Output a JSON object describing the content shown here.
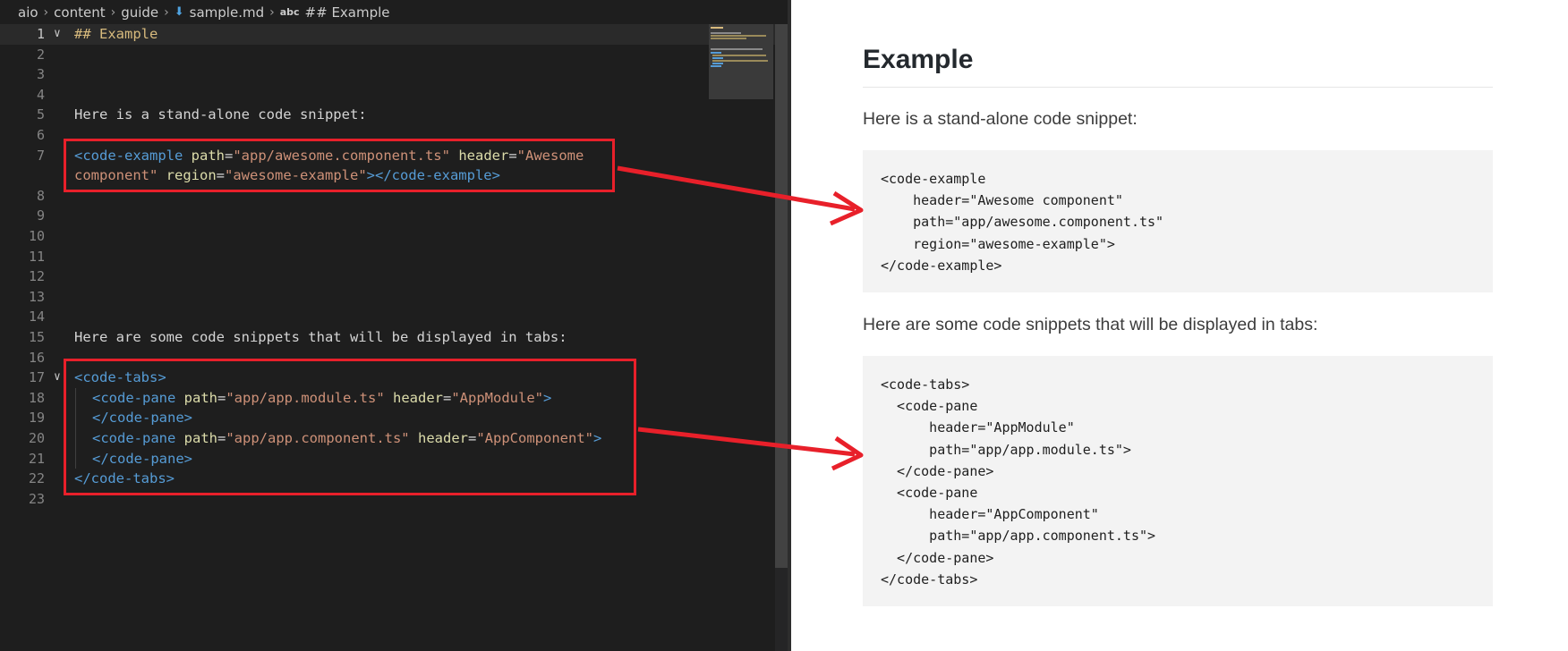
{
  "breadcrumb": {
    "items": [
      "aio",
      "content",
      "guide",
      "sample.md",
      "## Example"
    ],
    "separator": "›",
    "file_icon": "markdown-file-icon",
    "symbol_icon": "abc-symbol-icon",
    "symbol_icon_text": "abc"
  },
  "editor": {
    "line_numbers": [
      "1",
      "2",
      "3",
      "4",
      "5",
      "6",
      "7",
      "8",
      "9",
      "10",
      "11",
      "12",
      "13",
      "14",
      "15",
      "16",
      "17",
      "18",
      "19",
      "20",
      "21",
      "22",
      "23"
    ],
    "line1": "## Example",
    "line5": "Here is a stand-alone code snippet:",
    "line15": "Here are some code snippets that will be displayed in tabs:",
    "line7a": {
      "open": "<code-example",
      "path_attr": "path",
      "path_val": "\"app/awesome.component.ts\"",
      "header_attr": "header",
      "header_val_part1": "\"Awesome"
    },
    "line7b": {
      "header_val_part2": "component\"",
      "region_attr": "region",
      "region_val": "\"awesome-example\"",
      "close": "></code-example>"
    },
    "line17": "<code-tabs>",
    "line18": {
      "open": "<code-pane",
      "path_attr": "path",
      "path_val": "\"app/app.module.ts\"",
      "header_attr": "header",
      "header_val": "\"AppModule\"",
      "close": ">"
    },
    "line19": "</code-pane>",
    "line20": {
      "open": "<code-pane",
      "path_attr": "path",
      "path_val": "\"app/app.component.ts\"",
      "header_attr": "header",
      "header_val": "\"AppComponent\"",
      "close": ">"
    },
    "line21": "</code-pane>",
    "line22": "</code-tabs>"
  },
  "preview": {
    "title": "Example",
    "para1": "Here is a stand-alone code snippet:",
    "code1": "<code-example\n    header=\"Awesome component\"\n    path=\"app/awesome.component.ts\"\n    region=\"awesome-example\">\n</code-example>",
    "para2": "Here are some code snippets that will be displayed in tabs:",
    "code2": "<code-tabs>\n  <code-pane\n      header=\"AppModule\"\n      path=\"app/app.module.ts\">\n  </code-pane>\n  <code-pane\n      header=\"AppComponent\"\n      path=\"app/app.component.ts\">\n  </code-pane>\n</code-tabs>"
  },
  "colors": {
    "editor_bg": "#1e1e1e",
    "tag": "#569cd6",
    "attribute": "#dcdcaa",
    "string": "#ce9178",
    "annotation_red": "#e8202a"
  }
}
